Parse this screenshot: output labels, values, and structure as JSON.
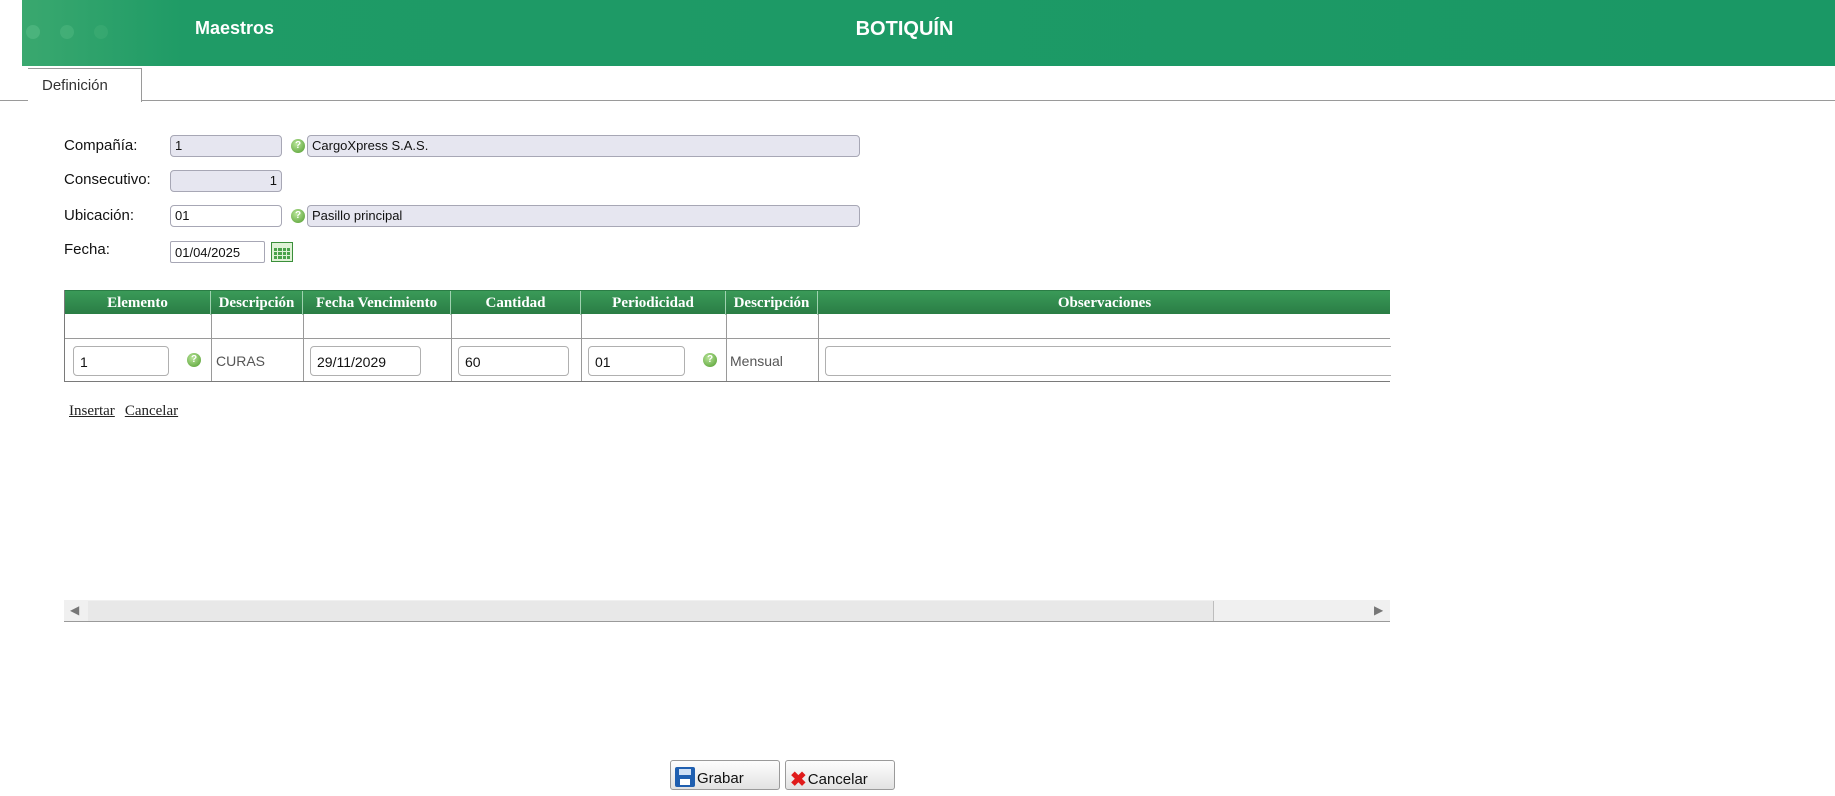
{
  "header": {
    "module": "Maestros",
    "title": "BOTIQUÍN"
  },
  "tabs": [
    {
      "label": "Definición"
    }
  ],
  "form": {
    "compania_label": "Compañía:",
    "compania_code": "1",
    "compania_name": "CargoXpress S.A.S.",
    "consecutivo_label": "Consecutivo:",
    "consecutivo_value": "1",
    "ubicacion_label": "Ubicación:",
    "ubicacion_code": "01",
    "ubicacion_name": "Pasillo principal",
    "fecha_label": "Fecha:",
    "fecha_value": "01/04/2025"
  },
  "grid": {
    "columns": [
      "Elemento",
      "Descripción",
      "Fecha Vencimiento",
      "Cantidad",
      "Periodicidad",
      "Descripción",
      "Observaciones"
    ],
    "row": {
      "elemento": "1",
      "descripcion": "CURAS",
      "fecha_vencimiento": "29/11/2029",
      "cantidad": "60",
      "periodicidad": "01",
      "periodicidad_desc": "Mensual",
      "observaciones": ""
    }
  },
  "links": {
    "insertar": "Insertar",
    "cancelar": "Cancelar"
  },
  "buttons": {
    "grabar": "Grabar",
    "cancelar": "Cancelar"
  },
  "icons": {
    "help": "help-icon",
    "calendar": "calendar-icon",
    "save": "save-icon",
    "cancel": "cancel-x-icon"
  },
  "colors": {
    "header_green": "#1a9865",
    "grid_header": "#2a7d45",
    "help_green": "#4f9b2c",
    "cancel_red": "#e01b1b"
  }
}
